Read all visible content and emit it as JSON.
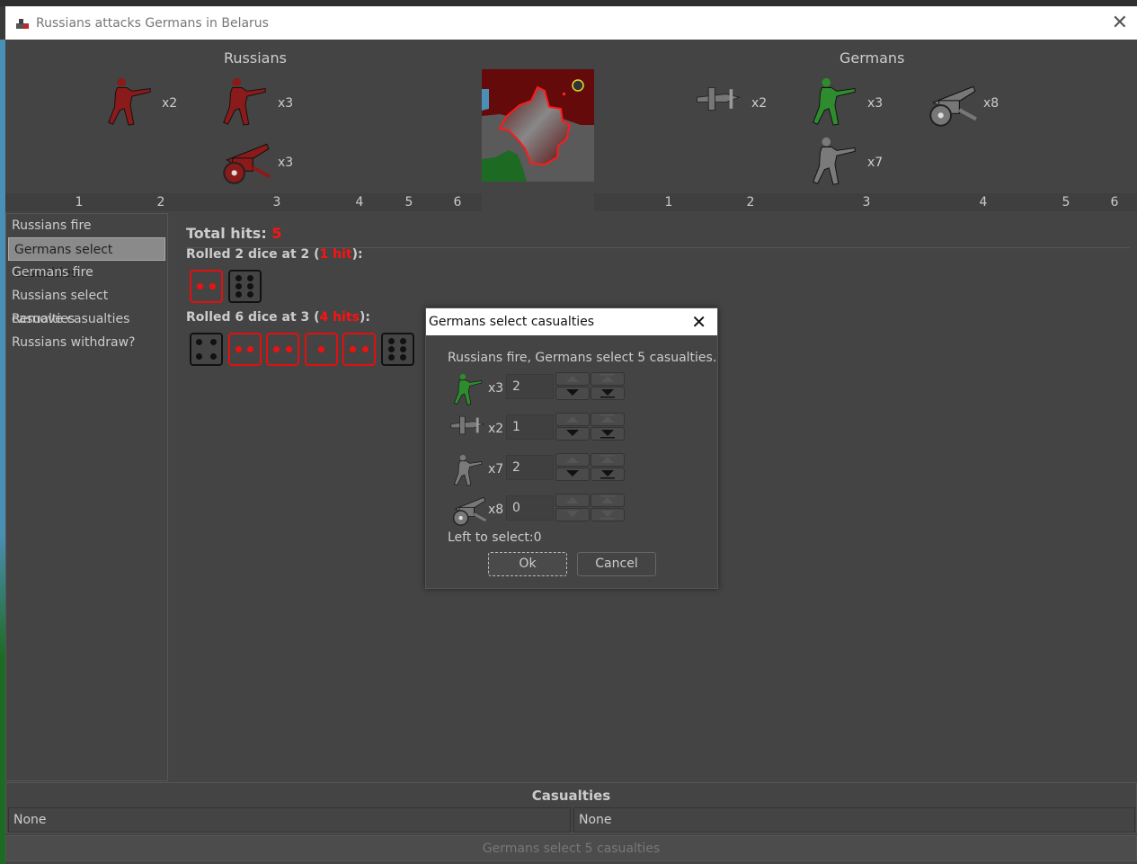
{
  "window": {
    "title": "Russians attacks Germans in Belarus",
    "icon": "tank-artillery-icon"
  },
  "attacker": {
    "name": "Russians",
    "color": "#8b1a1a",
    "units": [
      {
        "type": "infantry",
        "count": "x2",
        "column": 1
      },
      {
        "type": "infantry",
        "count": "x3",
        "column": 3
      },
      {
        "type": "artillery",
        "count": "x3",
        "column": 3
      }
    ],
    "columns": [
      "1",
      "2",
      "3",
      "4",
      "5",
      "6"
    ]
  },
  "defender": {
    "name": "Germans",
    "units": [
      {
        "type": "fighter",
        "count": "x2",
        "color": "#777777"
      },
      {
        "type": "infantry",
        "count": "x3",
        "color": "#2e8b2e"
      },
      {
        "type": "artillery",
        "count": "x8",
        "color": "#777777"
      },
      {
        "type": "infantry",
        "count": "x7",
        "color": "#7a7a7a"
      }
    ],
    "columns": [
      "1",
      "2",
      "3",
      "4",
      "5",
      "6"
    ]
  },
  "steps": [
    {
      "label": "Russians fire",
      "selected": false
    },
    {
      "label": "Germans select casualties",
      "selected": true
    },
    {
      "label": "Germans fire",
      "selected": false
    },
    {
      "label": "Russians select casualties",
      "selected": false
    },
    {
      "label": "Remove casualties",
      "selected": false
    },
    {
      "label": "Russians withdraw?",
      "selected": false
    }
  ],
  "results": {
    "total_label": "Total hits:",
    "total": "5",
    "rolls": [
      {
        "prefix": "Rolled 2 dice at 2 (",
        "hits": "1 hit",
        "suffix": "):",
        "dice": [
          {
            "v": 2,
            "hit": true
          },
          {
            "v": 6,
            "hit": false
          }
        ]
      },
      {
        "prefix": "Rolled 6 dice at 3 (",
        "hits": "4 hits",
        "suffix": "):",
        "dice": [
          {
            "v": 4,
            "hit": false
          },
          {
            "v": 2,
            "hit": true
          },
          {
            "v": 2,
            "hit": true
          },
          {
            "v": 1,
            "hit": true
          },
          {
            "v": 2,
            "hit": true
          },
          {
            "v": 6,
            "hit": false
          }
        ]
      }
    ]
  },
  "casualties": {
    "title": "Casualties",
    "left": "None",
    "right": "None"
  },
  "status_button": "Germans select 5 casualties",
  "dialog": {
    "title": "Germans select casualties",
    "message": "Russians fire,  Germans select 5 casualties.",
    "rows": [
      {
        "type": "infantry",
        "color": "#2e8b2e",
        "count": "x3",
        "value": "2",
        "can_decrease": true
      },
      {
        "type": "fighter",
        "color": "#777777",
        "count": "x2",
        "value": "1",
        "can_decrease": true
      },
      {
        "type": "infantry",
        "color": "#7a7a7a",
        "count": "x7",
        "value": "2",
        "can_decrease": true
      },
      {
        "type": "artillery",
        "color": "#777777",
        "count": "x8",
        "value": "0",
        "can_decrease": false
      }
    ],
    "left_to_select": "Left to select:0",
    "ok": "Ok",
    "cancel": "Cancel"
  }
}
